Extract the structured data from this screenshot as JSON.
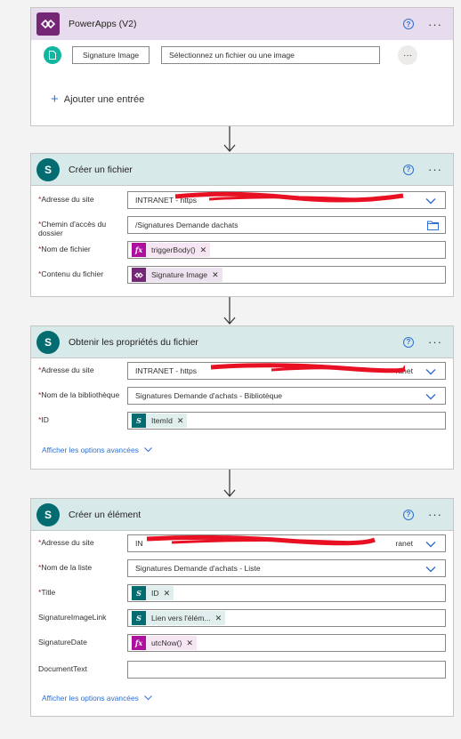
{
  "trigger": {
    "title": "PowerApps (V2)",
    "input_name": "Signature Image",
    "input_placeholder": "Sélectionnez un fichier ou une image",
    "add_entry": "Ajouter une entrée"
  },
  "create_file": {
    "title": "Créer un fichier",
    "site_label": "Adresse du site",
    "site_value": "INTRANET - https",
    "folder_label": "Chemin d'accès du dossier",
    "folder_value": "/Signatures Demande dachats",
    "filename_label": "Nom de fichier",
    "filename_token": "triggerBody()",
    "content_label": "Contenu du fichier",
    "content_token": "Signature Image"
  },
  "get_props": {
    "title": "Obtenir les propriétés du fichier",
    "site_label": "Adresse du site",
    "site_value": "INTRANET - https",
    "site_tail": "ranet",
    "library_label": "Nom de la bibliothèque",
    "library_value": "Signatures Demande d'achats - Bibliotèque",
    "id_label": "ID",
    "id_token": "ItemId",
    "advanced": "Afficher les options avancées"
  },
  "create_item": {
    "title": "Créer un élément",
    "site_label": "Adresse du site",
    "site_value": "IN",
    "site_tail": "ranet",
    "list_label": "Nom de la liste",
    "list_value": "Signatures Demande d'achats - Liste",
    "title_label": "Title",
    "title_token": "ID",
    "link_label": "SignatureImageLink",
    "link_token": "Lien vers l'élém...",
    "date_label": "SignatureDate",
    "date_token": "utcNow()",
    "doc_label": "DocumentText",
    "advanced": "Afficher les options avancées"
  },
  "required_mark": "*",
  "colors": {
    "powerapps": "#742774",
    "sharepoint": "#036c70",
    "expression": "#ad0f9f",
    "link": "#2f6fd1",
    "redaction": "#e81123"
  }
}
